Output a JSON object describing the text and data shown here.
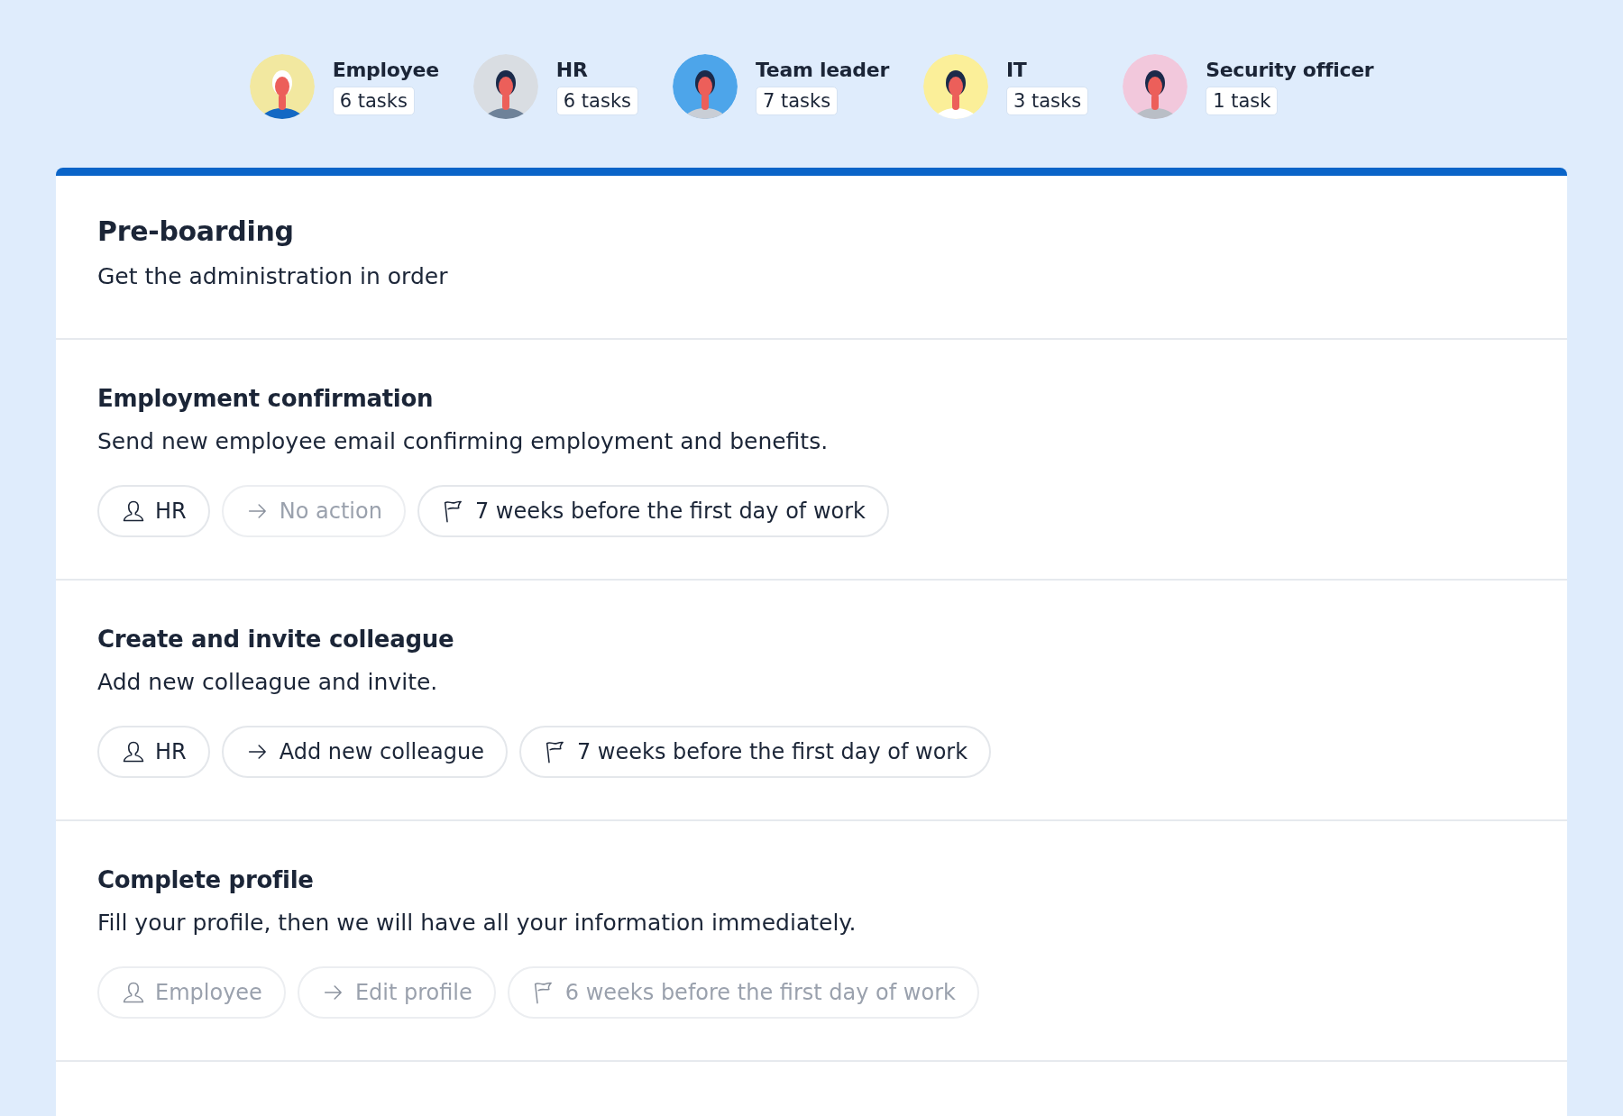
{
  "assignees": [
    {
      "name": "Employee",
      "tasks": "6 tasks",
      "color": "#f2e8a0"
    },
    {
      "name": "HR",
      "tasks": "6 tasks",
      "color": "#d9dde2"
    },
    {
      "name": "Team leader",
      "tasks": "7 tasks",
      "color": "#4da5ea"
    },
    {
      "name": "IT",
      "tasks": "3 tasks",
      "color": "#fbef99"
    },
    {
      "name": "Security officer",
      "tasks": "1 task",
      "color": "#f2c8dc"
    }
  ],
  "phase": {
    "title": "Pre-boarding",
    "subtitle": "Get the administration in order"
  },
  "tasks": [
    {
      "title": "Employment confirmation",
      "description": "Send new employee email confirming employment and benefits.",
      "chips": [
        {
          "kind": "assignee",
          "label": "HR",
          "disabled": false
        },
        {
          "kind": "action",
          "label": "No action",
          "disabled": true
        },
        {
          "kind": "deadline",
          "label": "7 weeks before the first day of work",
          "disabled": false
        }
      ]
    },
    {
      "title": "Create and invite colleague",
      "description": "Add new colleague and invite.",
      "chips": [
        {
          "kind": "assignee",
          "label": "HR",
          "disabled": false
        },
        {
          "kind": "action",
          "label": "Add new colleague",
          "disabled": false
        },
        {
          "kind": "deadline",
          "label": "7 weeks before the first day of work",
          "disabled": false
        }
      ]
    },
    {
      "title": "Complete profile",
      "description": "Fill your profile, then we will have all your information immediately.",
      "chips": [
        {
          "kind": "assignee",
          "label": "Employee",
          "disabled": true
        },
        {
          "kind": "action",
          "label": "Edit profile",
          "disabled": true
        },
        {
          "kind": "deadline",
          "label": "6 weeks before the first day of work",
          "disabled": true
        }
      ]
    }
  ]
}
